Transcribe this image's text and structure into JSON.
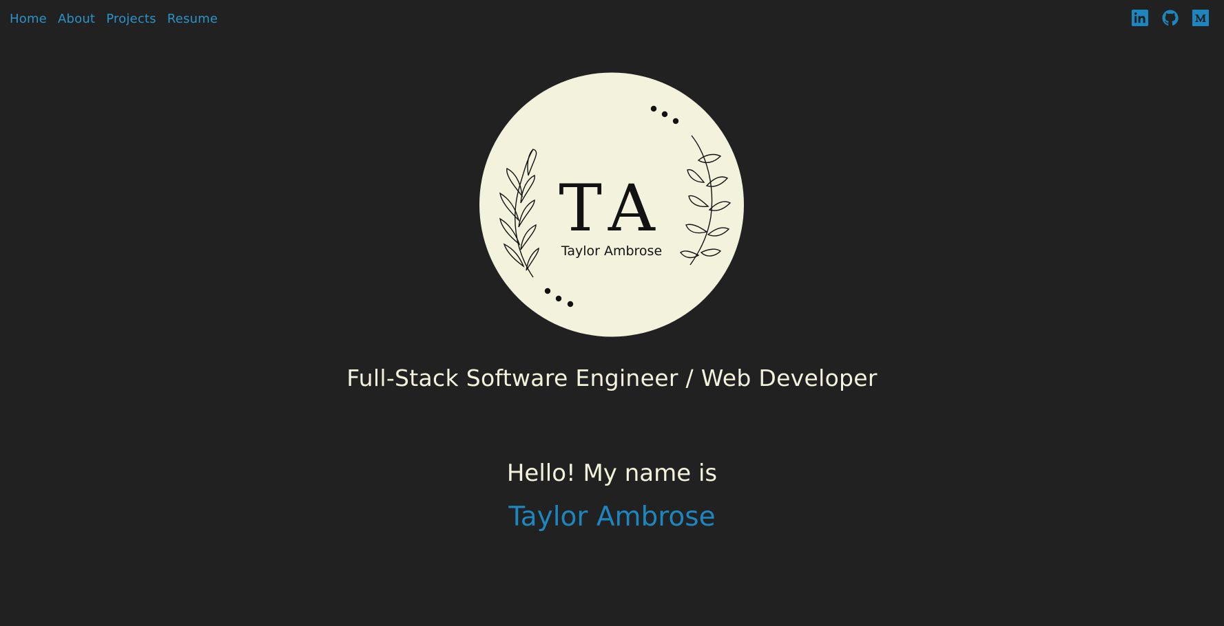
{
  "nav": {
    "items": [
      {
        "label": "Home"
      },
      {
        "label": "About"
      },
      {
        "label": "Projects"
      },
      {
        "label": "Resume"
      }
    ]
  },
  "social": {
    "icons": [
      "linkedin-icon",
      "github-icon",
      "medium-icon"
    ],
    "accent": "#1e86be"
  },
  "logo": {
    "monogram": "TA",
    "name": "Taylor Ambrose",
    "circle_color": "#f3f2dc"
  },
  "hero": {
    "tagline": "Full-Stack Software Engineer / Web Developer",
    "hello": "Hello! My name is",
    "name": "Taylor Ambrose"
  },
  "colors": {
    "background": "#212121",
    "link": "#2a93c7",
    "text": "#f3f2dc",
    "name": "#1e86be"
  }
}
